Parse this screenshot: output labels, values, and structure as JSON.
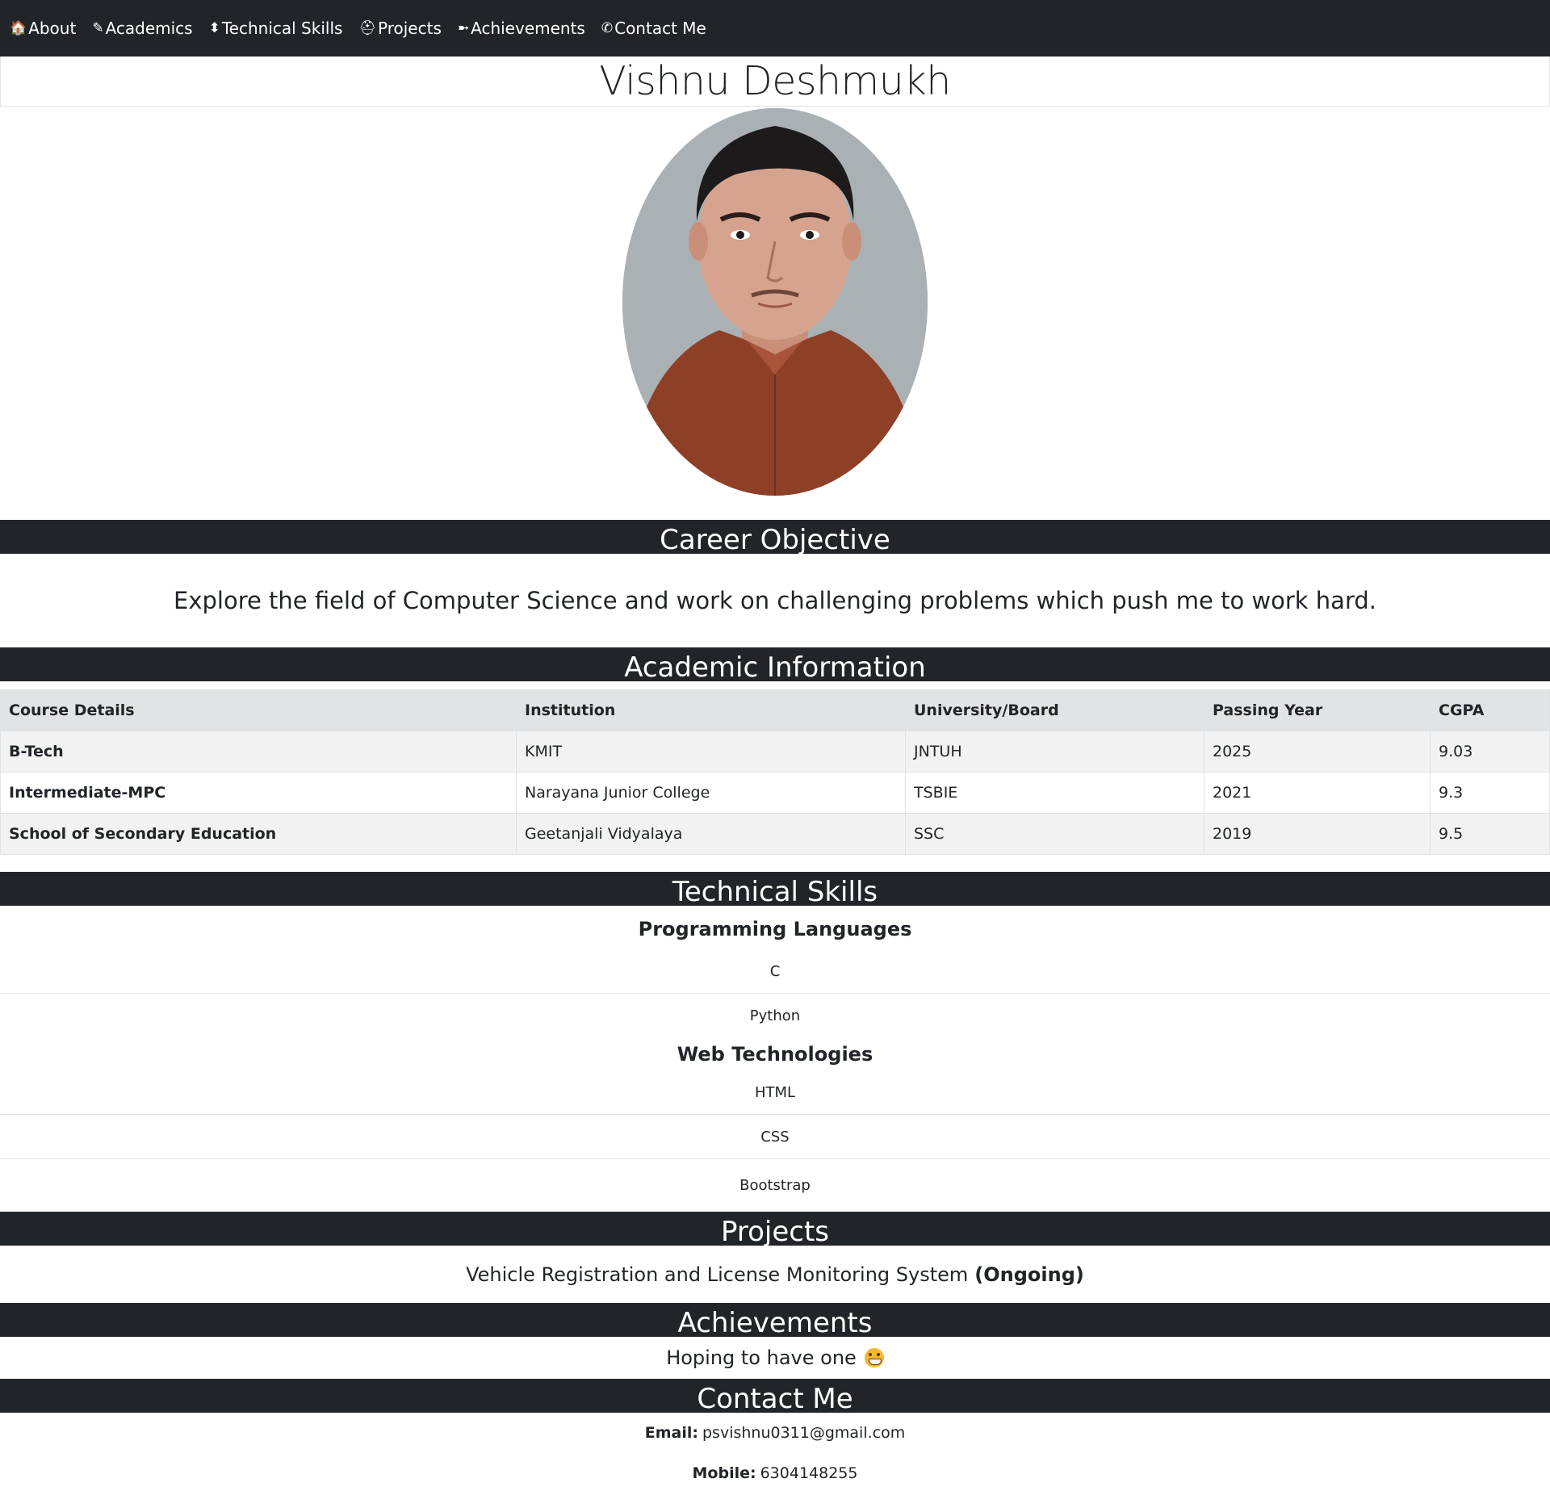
{
  "nav": [
    {
      "icon": "🏠",
      "label": "About"
    },
    {
      "icon": "✎",
      "label": "Academics"
    },
    {
      "icon": "⬍",
      "label": "Technical Skills"
    },
    {
      "icon": "⛑",
      "label": "Projects"
    },
    {
      "icon": "➼",
      "label": "Achievements"
    },
    {
      "icon": "✆",
      "label": "Contact Me"
    }
  ],
  "name": "Vishnu Deshmukh",
  "sections": {
    "career": "Career Objective",
    "academic": "Academic Information",
    "skills": "Technical Skills",
    "projects": "Projects",
    "achievements": "Achievements",
    "contact": "Contact Me"
  },
  "objective": "Explore the field of Computer Science and work on challenging problems which push me to work hard.",
  "academic_table": {
    "headers": [
      "Course Details",
      "Institution",
      "University/Board",
      "Passing Year",
      "CGPA"
    ],
    "rows": [
      [
        "B-Tech",
        "KMIT",
        "JNTUH",
        "2025",
        "9.03"
      ],
      [
        "Intermediate-MPC",
        "Narayana Junior College",
        "TSBIE",
        "2021",
        "9.3"
      ],
      [
        "School of Secondary Education",
        "Geetanjali Vidyalaya",
        "SSC",
        "2019",
        "9.5"
      ]
    ]
  },
  "skills": {
    "programming_title": "Programming Languages",
    "programming": [
      "C",
      "Python"
    ],
    "web_title": "Web Technologies",
    "web": [
      "HTML",
      "CSS",
      "Bootstrap"
    ]
  },
  "project": {
    "title": "Vehicle Registration and License Monitoring System",
    "status": "(Ongoing)"
  },
  "achievement": "Hoping to have one",
  "contact": {
    "email_label": "Email:",
    "email": "psvishnu0311@gmail.com",
    "mobile_label": "Mobile:",
    "mobile": "6304148255"
  }
}
